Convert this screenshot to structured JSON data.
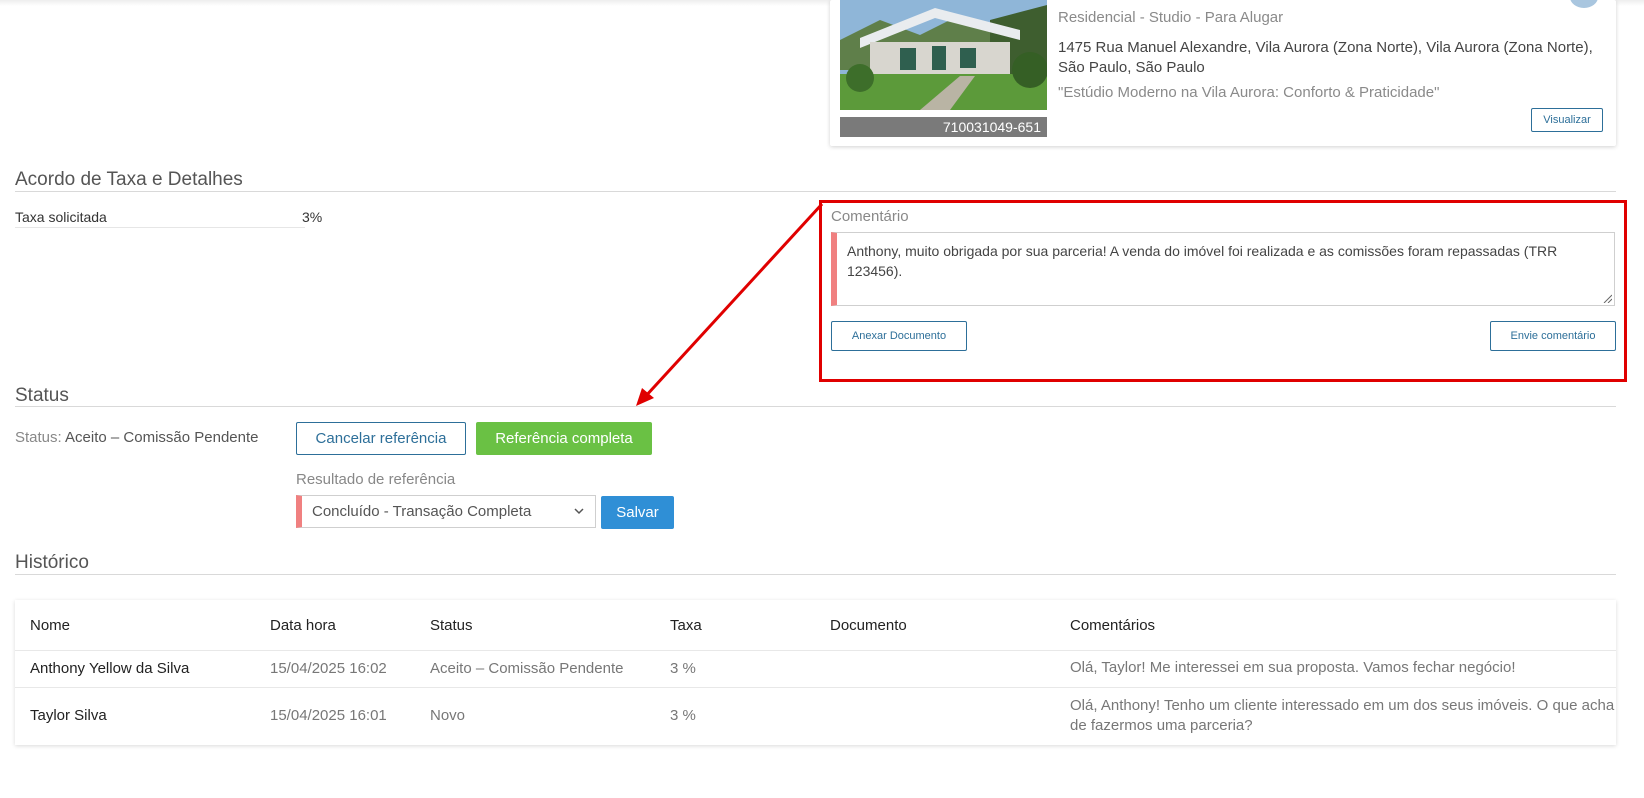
{
  "property": {
    "type": "Residencial - Studio - Para Alugar",
    "address": "1475 Rua Manuel Alexandre, Vila Aurora (Zona Norte), Vila Aurora (Zona Norte), São Paulo, São Paulo",
    "quote": "\"Estúdio Moderno na Vila Aurora: Conforto & Praticidade\"",
    "id": "710031049-651",
    "view_label": "Visualizar"
  },
  "fee_section": {
    "title": "Acordo de Taxa e Detalhes",
    "fee_label": "Taxa solicitada",
    "fee_value": "3%"
  },
  "comment": {
    "label": "Comentário",
    "text": "Anthony, muito obrigada por sua parceria! A venda do imóvel foi realizada e as comissões foram repassadas (TRR 123456).",
    "attach_label": "Anexar Documento",
    "send_label": "Envie comentário"
  },
  "status_section": {
    "title": "Status",
    "status_prefix": "Status:",
    "status_value": "Aceito – Comissão Pendente",
    "cancel_label": "Cancelar referência",
    "complete_label": "Referência completa",
    "result_label": "Resultado de referência",
    "result_value": "Concluído - Transação Completa",
    "save_label": "Salvar"
  },
  "history": {
    "title": "Histórico",
    "columns": [
      "Nome",
      "Data hora",
      "Status",
      "Taxa",
      "Documento",
      "Comentários"
    ],
    "rows": [
      {
        "name": "Anthony Yellow da Silva",
        "datetime": "15/04/2025 16:02",
        "status": "Aceito – Comissão Pendente",
        "fee": "3 %",
        "document": "",
        "comment": "Olá, Taylor! Me interessei em sua proposta. Vamos fechar negócio!"
      },
      {
        "name": "Taylor Silva",
        "datetime": "15/04/2025 16:01",
        "status": "Novo",
        "fee": "3 %",
        "document": "",
        "comment": "Olá, Anthony! Tenho um cliente interessado em um dos seus imóveis. O que acha de fazermos uma parceria?"
      }
    ]
  },
  "colors": {
    "accent_blue": "#2d6f99",
    "success_green": "#6ac144",
    "save_blue": "#2f8fd6",
    "highlight_red": "#e00000",
    "required_pink": "#f08080"
  }
}
